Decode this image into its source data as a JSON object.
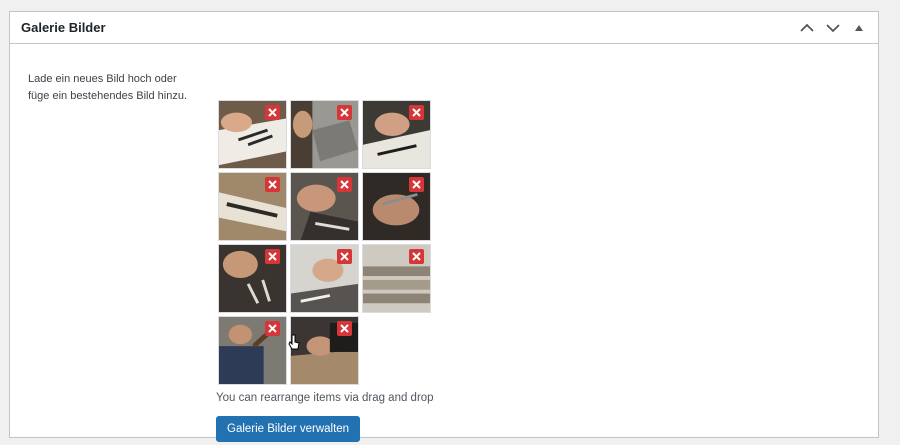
{
  "metabox": {
    "title": "Galerie Bilder",
    "controls": [
      {
        "name": "move-up",
        "icon": "chevron-up-icon"
      },
      {
        "name": "move-down",
        "icon": "chevron-down-icon"
      },
      {
        "name": "toggle-panel",
        "icon": "triangle-up-icon"
      }
    ]
  },
  "description": "Lade ein neues Bild hoch oder füge ein bestehendes Bild hinzu.",
  "gallery": {
    "images": [
      {
        "motif": "hand-writing-sign",
        "remove_icon": "close-icon"
      },
      {
        "motif": "craftsman-blade",
        "remove_icon": "close-icon"
      },
      {
        "motif": "hand-lettered-panel",
        "remove_icon": "close-icon"
      },
      {
        "motif": "carved-letters-board",
        "remove_icon": "close-icon"
      },
      {
        "motif": "hands-chiseling-letters",
        "remove_icon": "close-icon"
      },
      {
        "motif": "hands-holding-tool",
        "remove_icon": "close-icon"
      },
      {
        "motif": "lettering-slate",
        "remove_icon": "close-icon"
      },
      {
        "motif": "engraving-closeup",
        "remove_icon": "close-icon"
      },
      {
        "motif": "stone-rollers",
        "remove_icon": "close-icon"
      },
      {
        "motif": "mallet-chisel-worker",
        "remove_icon": "close-icon"
      },
      {
        "motif": "workbench-carving",
        "remove_icon": "close-icon"
      }
    ]
  },
  "hint": "You can rearrange items via drag and drop",
  "manage_button": "Galerie Bilder verwalten",
  "colors": {
    "primary_button": "#2271b1",
    "remove_button": "#d63638",
    "border": "#c3c4c7",
    "background": "#f0f0f1"
  }
}
